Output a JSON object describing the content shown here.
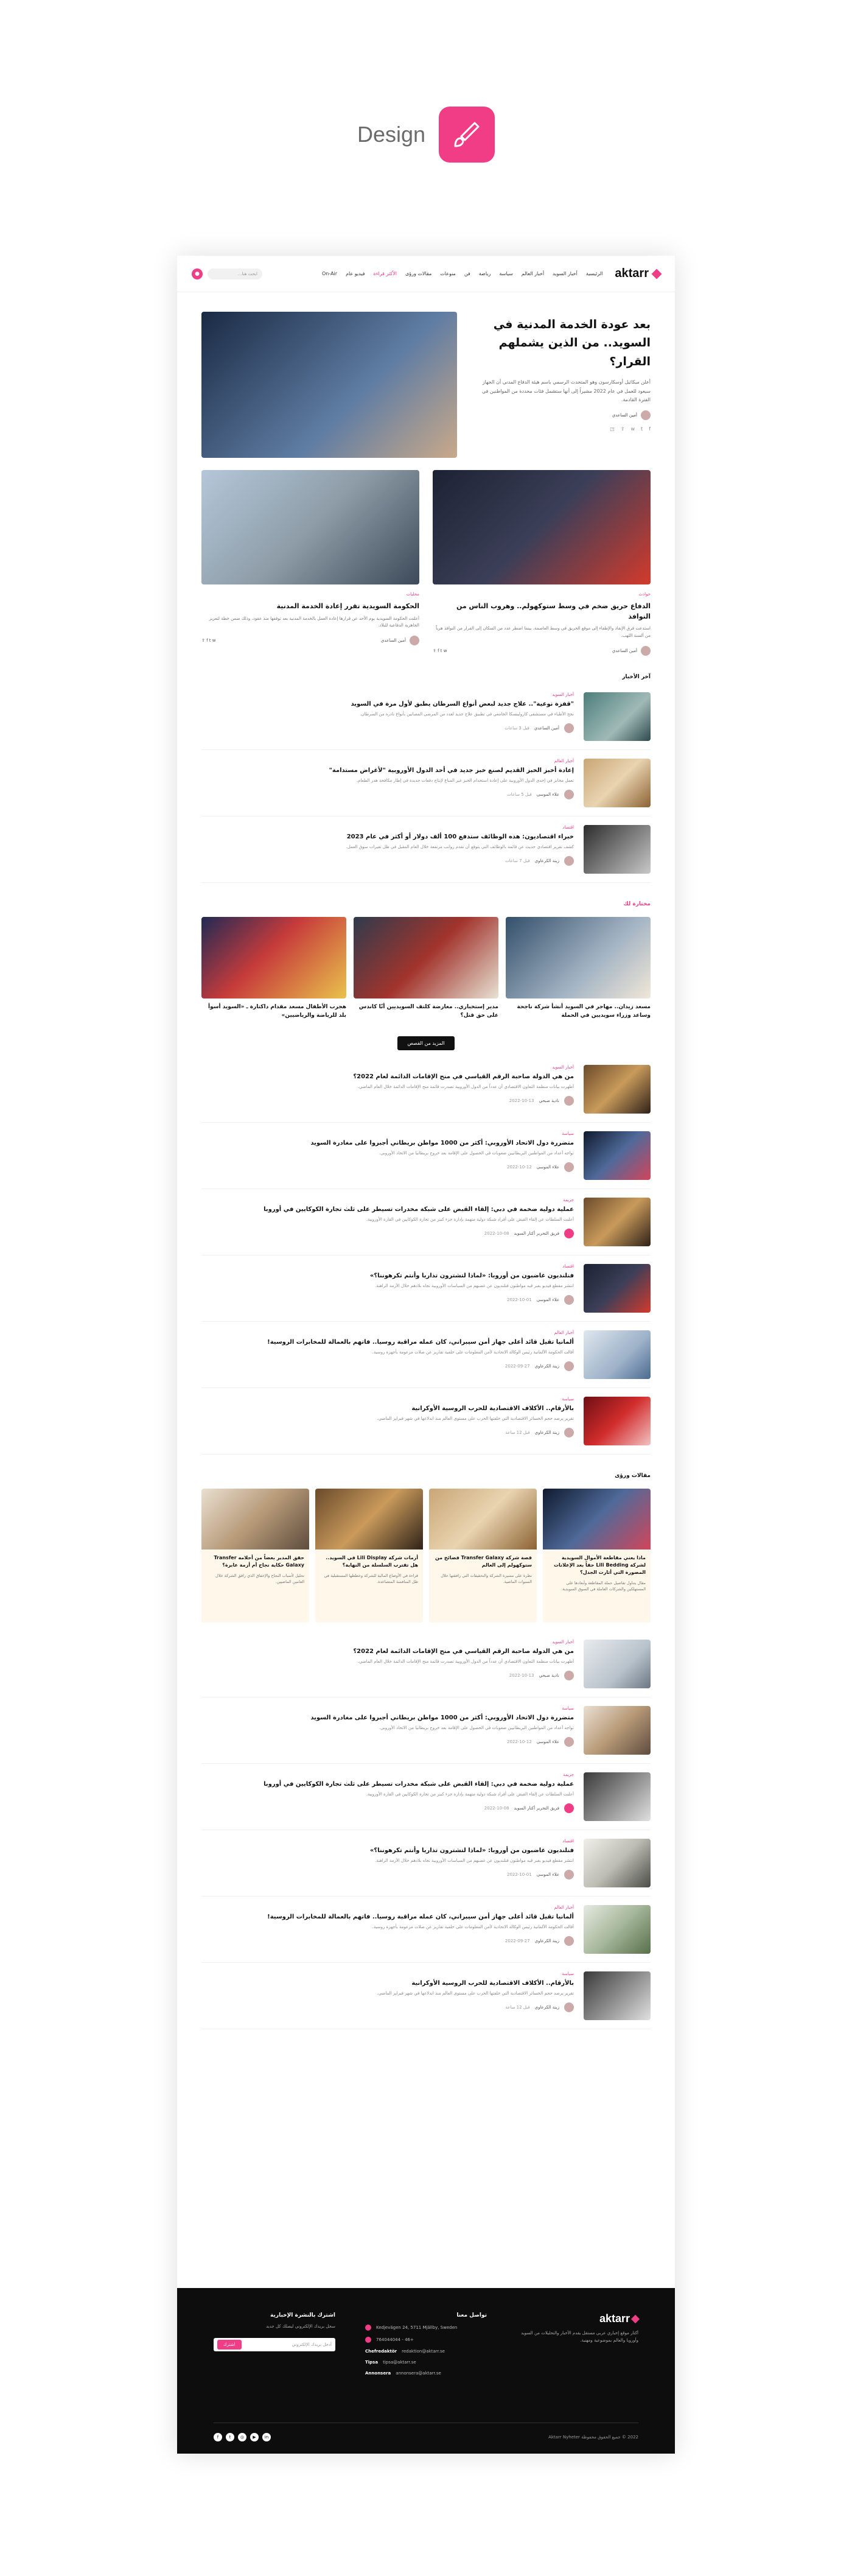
{
  "showcase": {
    "title": "Design"
  },
  "site": {
    "logo": "aktarr",
    "nav": [
      "الرئيسية",
      "أخبار السويد",
      "أخبار العالم",
      "سياسة",
      "رياضة",
      "فن",
      "منوعات",
      "مقالات ورؤى",
      "الأكثر قراءة",
      "فيديو عام",
      "On-Air"
    ],
    "search_placeholder": "ابحث هنا..."
  },
  "hero": {
    "title": "بعد عودة الخدمة المدنية في السويد.. من الذين يشملهم القرار؟",
    "excerpt": "أعلن ميكائيل أوسكارسون وهو المتحدث الرسمي باسم هيئة الدفاع المدني أن الجهاز سيعود للعمل في عام 2022 مشيراً إلى أنها ستشمل فئات محددة من المواطنين في الفترة القادمة.",
    "author": "أمين الساعدي"
  },
  "featured": [
    {
      "cat": "محليات",
      "title": "الحكومة السويدية تقرر إعادة الخدمة المدنية",
      "excerpt": "أعلنت الحكومة السويدية يوم الأحد عن قرارها إعادة العمل بالخدمة المدنية بعد توقفها منذ عقود، وذلك ضمن خطة لتعزيز الجاهزية الدفاعية للبلاد.",
      "author": "أمين الساعدي"
    },
    {
      "cat": "حوادث",
      "title": "الدفاع حريق ضخم في وسط ستوكهولم.. وهروب الناس من النوافذ",
      "excerpt": "استدعت فرق الإنقاذ والإطفاء إلى موقع الحريق في وسط العاصمة، بينما اضطر عدد من السكان إلى الفرار من النوافذ هرباً من ألسنة اللهب.",
      "author": "أمين الساعدي"
    }
  ],
  "latest_label": "آخر الأخبار",
  "latest": [
    {
      "cat": "أخبار السويد",
      "title": "\"قفزة نوعية\".. علاج جديد لبعض أنواع السرطان يطبق لأول مرة في السويد",
      "excerpt": "نجح الأطباء في مستشفى كارولينسكا الجامعي في تطبيق علاج جديد لعدد من المرضى المصابين بأنواع نادرة من السرطان.",
      "author": "أمين الساعدي",
      "date": "قبل 3 ساعات"
    },
    {
      "cat": "أخبار العالم",
      "title": "إعادة أخبز الخبز القديم لصنع خبز جديد في أحد الدول الأوروبية \"لأغراض مستدامة\"",
      "excerpt": "تعمل مخابز في إحدى الدول الأوروبية على إعادة استخدام الخبز غير المباع لإنتاج دفعات جديدة في إطار مكافحة هدر الطعام.",
      "author": "علاء الموسى",
      "date": "قبل 5 ساعات"
    },
    {
      "cat": "اقتصاد",
      "title": "خبراء اقتصاديون: هذه الوظائف ستدفع 100 ألف دولار أو أكثر في عام 2023",
      "excerpt": "كشف تقرير اقتصادي حديث عن قائمة بالوظائف التي يتوقع أن تقدم رواتب مرتفعة خلال العام المقبل في ظل تغيرات سوق العمل.",
      "author": "زينة الكرعاوي",
      "date": "قبل 7 ساعات"
    }
  ],
  "picked_label": "مختارة لك",
  "picked": [
    {
      "title": "مسعد زيدان.. مهاجر في السويد أنشأ شركة ناجحة وساعد وزراء سويديين في الحملة"
    },
    {
      "title": "مدير إستخباري.. معارضة كلتف السويديين أنّا كاندس على حق قتل؟"
    },
    {
      "title": "هجرب الأطفال مسعد مقدام داكتارة ـ «السويد أسوأ بلد للرياضة والرياضيين»"
    }
  ],
  "more_button": "المزيد من القصص",
  "stories": [
    {
      "cat": "أخبار السويد",
      "title": "من هي الدولة صاحبة الرقم القياسي في منح الإقامات الدائمة لعام 2022؟",
      "excerpt": "أظهرت بيانات منظمة التعاون الاقتصادي أن عدداً من الدول الأوروبية تصدرت قائمة منح الإقامات الدائمة خلال العام الماضي.",
      "author": "نادية صبحي",
      "date": "2022-10-13"
    },
    {
      "cat": "سياسة",
      "title": "متضررة دول الاتحاد الأوروبي: أكثر من 1000 مواطن بريطاني أجبروا على مغادرة السويد",
      "excerpt": "تواجه أعداد من المواطنين البريطانيين صعوبات في الحصول على الإقامة بعد خروج بريطانيا من الاتحاد الأوروبي.",
      "author": "علاء الموسى",
      "date": "2022-10-12"
    },
    {
      "cat": "جريمة",
      "title": "عملية دولية ضخمة في دبي: إلقاء القبض على شبكة مخدرات تسيطر على ثلث تجارة الكوكايين في أوروبا",
      "excerpt": "أعلنت السلطات عن إلقاء القبض على أفراد شبكة دولية متهمة بإدارة جزء كبير من تجارة الكوكايين في القارة الأوروبية.",
      "author": "فريق التحرير أكتار السويد",
      "date": "2022-10-08"
    },
    {
      "cat": "اقتصاد",
      "title": "فنلنديون غاضبون من أوروبا: «لماذا لتشترون تذاريا وأنتم تكرهوننا؟»",
      "excerpt": "انتشر مقطع فيديو يعبر فيه مواطنون فنلنديون عن غضبهم من السياسات الأوروبية تجاه بلادهم خلال الأزمة الراهنة.",
      "author": "علاء الموسى",
      "date": "2022-10-01"
    },
    {
      "cat": "أخبار العالم",
      "title": "ألمانيا تقيل قائد أعلى جهاز أمن سيبراني، كان عمله مراقبة روسيا.. فاتهم بالعمالة للمخابرات الروسية!",
      "excerpt": "أقالت الحكومة الألمانية رئيس الوكالة الاتحادية لأمن المعلومات على خلفية تقارير عن صلات مزعومة بأجهزة روسية.",
      "author": "زينة الكرعاوي",
      "date": "2022-09-27"
    },
    {
      "cat": "سياسة",
      "title": "بالأرقام.. الأكلاف الاقتصادية للحرب الروسية الأوكرانية",
      "excerpt": "تقرير يرصد حجم الخسائر الاقتصادية التي خلفتها الحرب على مستوى العالم منذ اندلاعها في شهر فبراير الماضي.",
      "author": "زينة الكرعاوي",
      "date": "قبل 12 ساعة"
    }
  ],
  "articles_label": "مقالات ورؤى",
  "articles": [
    {
      "title": "ماذا يعني مقاطعة الأموال السويدية لشركة Lili Bedding حقاً بعد الإعلانات المصورة التي أثارت الجدل؟",
      "excerpt": "مقال يتناول تفاصيل حملة المقاطعة وأبعادها على المستهلكين والشركات العاملة في السوق السويدية."
    },
    {
      "title": "قصة شركة Transfer Galaxy فضائح من ستوكهولم إلى العالم",
      "excerpt": "نظرة على مسيرة الشركة والتحقيقات التي رافقتها خلال السنوات الماضية."
    },
    {
      "title": "أزمات شركة Lili Display في السويد.. هل تقترب السلسلة من النهاية؟",
      "excerpt": "قراءة في الأوضاع المالية للشركة وخططها المستقبلية في ظل المنافسة المتصاعدة."
    },
    {
      "title": "حقق المدير بعضاً من أحلامه Transfer Galaxy حكاية نجاح أم أزمة عابرة؟",
      "excerpt": "تحليل لأسباب النجاح والإخفاق الذي رافق الشركة خلال العامين الماضيين."
    }
  ],
  "stories2": [
    {
      "cat": "أخبار السويد",
      "title": "من هي الدولة صاحبة الرقم القياسي في منح الإقامات الدائمة لعام 2022؟",
      "excerpt": "أظهرت بيانات منظمة التعاون الاقتصادي أن عدداً من الدول الأوروبية تصدرت قائمة منح الإقامات الدائمة خلال العام الماضي.",
      "author": "نادية صبحي",
      "date": "2022-10-13"
    },
    {
      "cat": "سياسة",
      "title": "متضررة دول الاتحاد الأوروبي: أكثر من 1000 مواطن بريطاني أجبروا على مغادرة السويد",
      "excerpt": "تواجه أعداد من المواطنين البريطانيين صعوبات في الحصول على الإقامة بعد خروج بريطانيا من الاتحاد الأوروبي.",
      "author": "علاء الموسى",
      "date": "2022-10-12"
    },
    {
      "cat": "جريمة",
      "title": "عملية دولية ضخمة في دبي: إلقاء القبض على شبكة مخدرات تسيطر على ثلث تجارة الكوكايين في أوروبا",
      "excerpt": "أعلنت السلطات عن إلقاء القبض على أفراد شبكة دولية متهمة بإدارة جزء كبير من تجارة الكوكايين في القارة الأوروبية.",
      "author": "فريق التحرير أكتار السويد",
      "date": "2022-10-08"
    },
    {
      "cat": "اقتصاد",
      "title": "فنلنديون غاضبون من أوروبا: «لماذا لتشترون تذاريا وأنتم تكرهوننا؟»",
      "excerpt": "انتشر مقطع فيديو يعبر فيه مواطنون فنلنديون عن غضبهم من السياسات الأوروبية تجاه بلادهم خلال الأزمة الراهنة.",
      "author": "علاء الموسى",
      "date": "2022-10-01"
    },
    {
      "cat": "أخبار العالم",
      "title": "ألمانيا تقيل قائد أعلى جهاز أمن سيبراني، كان عمله مراقبة روسيا.. فاتهم بالعمالة للمخابرات الروسية!",
      "excerpt": "أقالت الحكومة الألمانية رئيس الوكالة الاتحادية لأمن المعلومات على خلفية تقارير عن صلات مزعومة بأجهزة روسية.",
      "author": "زينة الكرعاوي",
      "date": "2022-09-27"
    },
    {
      "cat": "سياسة",
      "title": "بالأرقام.. الأكلاف الاقتصادية للحرب الروسية الأوكرانية",
      "excerpt": "تقرير يرصد حجم الخسائر الاقتصادية التي خلفتها الحرب على مستوى العالم منذ اندلاعها في شهر فبراير الماضي.",
      "author": "زينة الكرعاوي",
      "date": "قبل 12 ساعة"
    }
  ],
  "footer": {
    "logo": "aktarr",
    "about": "أكتار موقع إخباري عربي مستقل يقدم الأخبار والتحليلات من السويد وأوروبا والعالم بموضوعية ومهنية.",
    "contact_title": "تواصل معنا",
    "address": "Kedjevägen 24, 5711 Mjällby, Sweden",
    "phone": "+46 - 764044044",
    "email_label": "Chefredaktör",
    "email": "redaktion@aktarr.se",
    "tips_label": "Tipsa",
    "tips": "tipsa@aktarr.se",
    "ads_label": "Annonsera",
    "ads": "annonsera@aktarr.se",
    "newsletter_title": "اشترك بالنشرة الإخبارية",
    "newsletter_text": "سجل بريدك الإلكتروني ليصلك كل جديد",
    "newsletter_placeholder": "أدخل بريدك الإلكتروني",
    "newsletter_button": "اشترك",
    "copyright": "2022 © جميع الحقوق محفوظة Aktarr Nyheter"
  }
}
